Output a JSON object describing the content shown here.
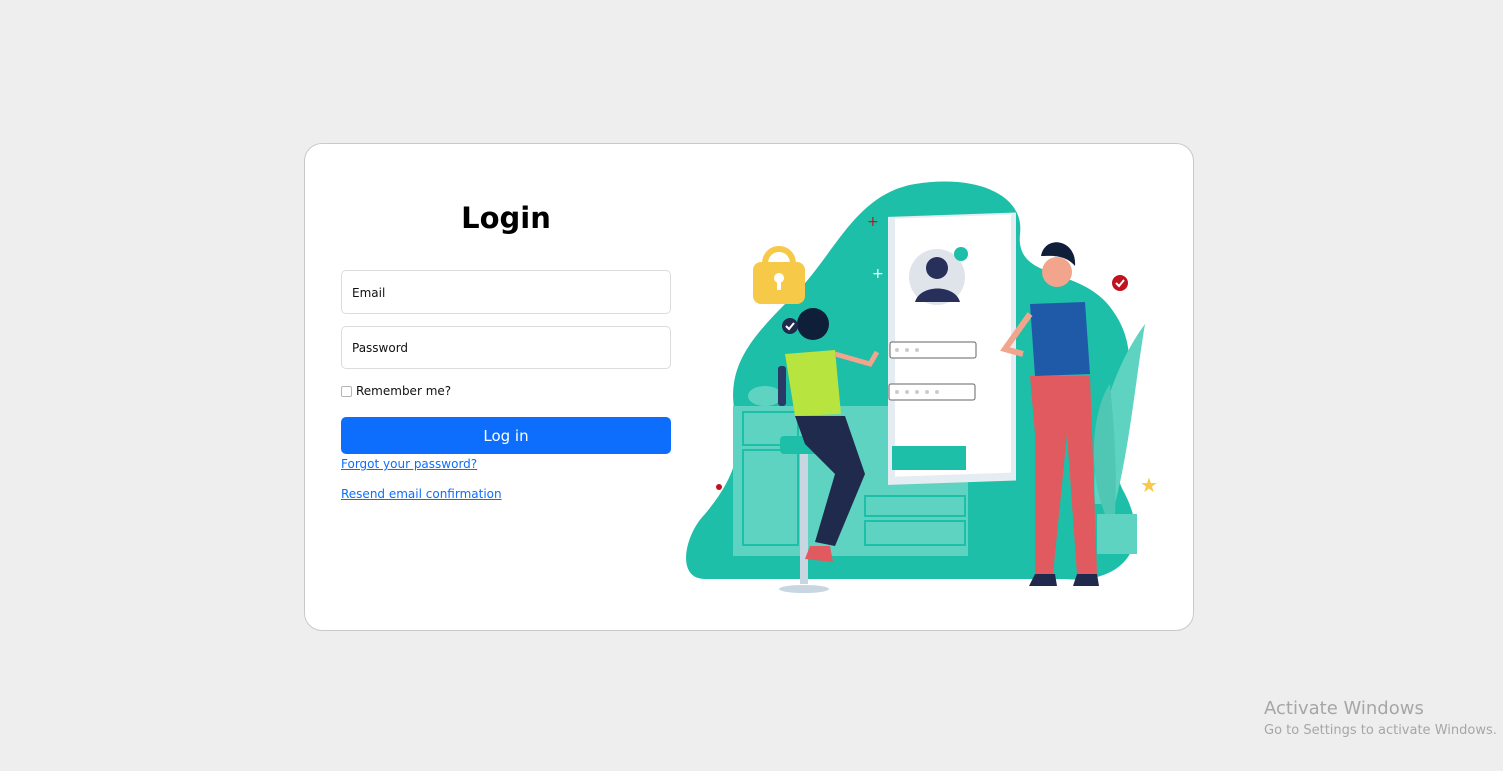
{
  "login": {
    "title": "Login",
    "email_placeholder": "Email",
    "password_placeholder": "Password",
    "remember_label": "Remember me?",
    "remember_checked": false,
    "login_button": "Log in",
    "forgot_link": "Forgot your password?",
    "resend_link": "Resend email confirmation"
  },
  "colors": {
    "primary": "#0d6efd",
    "teal": "#1dbfa8",
    "background": "#eeeeee"
  },
  "watermark": {
    "line1": "Activate Windows",
    "line2": "Go to Settings to activate Windows."
  }
}
